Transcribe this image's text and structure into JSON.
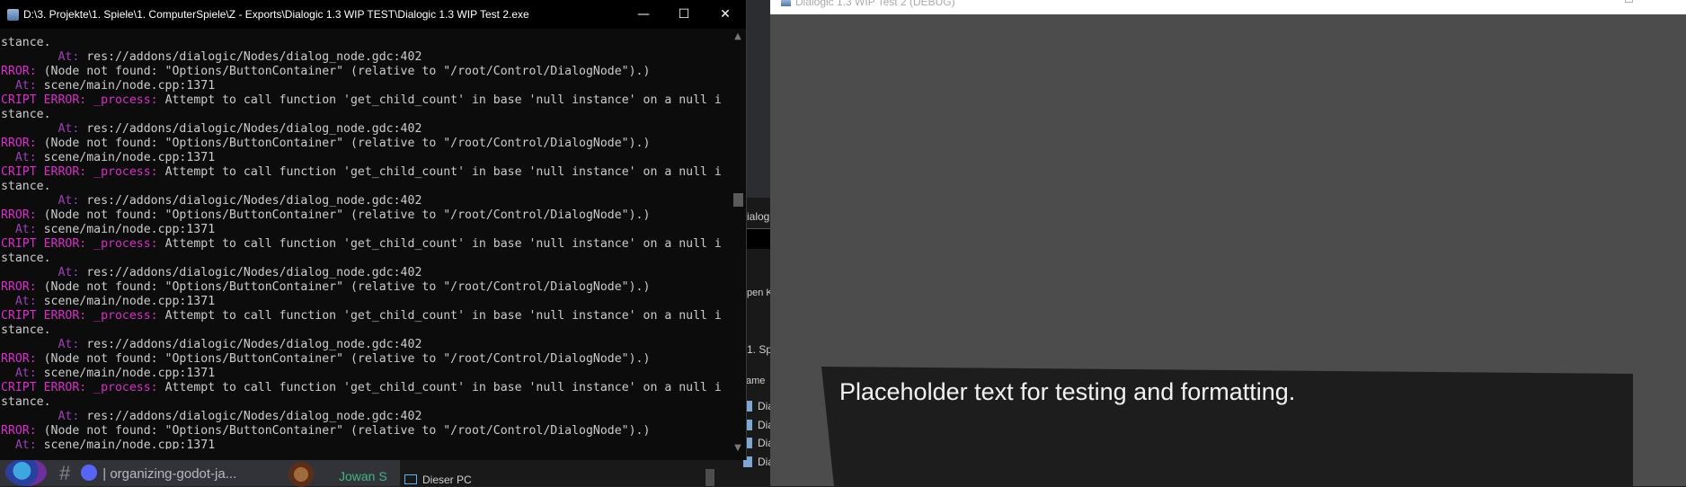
{
  "discord": {
    "channel": "| organizing-godot-ja...",
    "username": "Jowan S"
  },
  "explorer": {
    "labels": [
      "ialog",
      "pen K",
      "1. Sp",
      "ame"
    ],
    "files": [
      "Dia",
      "Dia",
      "Dia",
      "Dia"
    ],
    "this_pc": "Dieser PC"
  },
  "console": {
    "title": "D:\\3. Projekte\\1. Spiele\\1. ComputerSpiele\\Z - Exports\\Dialogic 1.3 WIP TEST\\Dialogic 1.3 WIP Test 2.exe",
    "lines": [
      {
        "pre": "",
        "text": "nstance."
      },
      {
        "pre": "         At: ",
        "text": "res://addons/dialogic/Nodes/dialog_node.gdc:402"
      },
      {
        "pre": "ERROR: ",
        "text": "(Node not found: \"Options/ButtonContainer\" (relative to \"/root/Control/DialogNode\").)"
      },
      {
        "pre": "   At: ",
        "text": "scene/main/node.cpp:1371"
      },
      {
        "pre": "SCRIPT ERROR: _process: ",
        "text": "Attempt to call function 'get_child_count' in base 'null instance' on a null i"
      },
      {
        "pre": "",
        "text": "nstance."
      },
      {
        "pre": "         At: ",
        "text": "res://addons/dialogic/Nodes/dialog_node.gdc:402"
      },
      {
        "pre": "ERROR: ",
        "text": "(Node not found: \"Options/ButtonContainer\" (relative to \"/root/Control/DialogNode\").)"
      },
      {
        "pre": "   At: ",
        "text": "scene/main/node.cpp:1371"
      },
      {
        "pre": "SCRIPT ERROR: _process: ",
        "text": "Attempt to call function 'get_child_count' in base 'null instance' on a null i"
      },
      {
        "pre": "",
        "text": "nstance."
      },
      {
        "pre": "         At: ",
        "text": "res://addons/dialogic/Nodes/dialog_node.gdc:402"
      },
      {
        "pre": "ERROR: ",
        "text": "(Node not found: \"Options/ButtonContainer\" (relative to \"/root/Control/DialogNode\").)"
      },
      {
        "pre": "   At: ",
        "text": "scene/main/node.cpp:1371"
      },
      {
        "pre": "SCRIPT ERROR: _process: ",
        "text": "Attempt to call function 'get_child_count' in base 'null instance' on a null i"
      },
      {
        "pre": "",
        "text": "nstance."
      },
      {
        "pre": "         At: ",
        "text": "res://addons/dialogic/Nodes/dialog_node.gdc:402"
      },
      {
        "pre": "ERROR: ",
        "text": "(Node not found: \"Options/ButtonContainer\" (relative to \"/root/Control/DialogNode\").)"
      },
      {
        "pre": "   At: ",
        "text": "scene/main/node.cpp:1371"
      },
      {
        "pre": "SCRIPT ERROR: _process: ",
        "text": "Attempt to call function 'get_child_count' in base 'null instance' on a null i"
      },
      {
        "pre": "",
        "text": "nstance."
      },
      {
        "pre": "         At: ",
        "text": "res://addons/dialogic/Nodes/dialog_node.gdc:402"
      },
      {
        "pre": "ERROR: ",
        "text": "(Node not found: \"Options/ButtonContainer\" (relative to \"/root/Control/DialogNode\").)"
      },
      {
        "pre": "   At: ",
        "text": "scene/main/node.cpp:1371"
      },
      {
        "pre": "SCRIPT ERROR: _process: ",
        "text": "Attempt to call function 'get_child_count' in base 'null instance' on a null i"
      },
      {
        "pre": "",
        "text": "nstance."
      },
      {
        "pre": "         At: ",
        "text": "res://addons/dialogic/Nodes/dialog_node.gdc:402"
      },
      {
        "pre": "ERROR: ",
        "text": "(Node not found: \"Options/ButtonContainer\" (relative to \"/root/Control/DialogNode\").)"
      },
      {
        "pre": "   At: ",
        "text": "scene/main/node.cpp:1371"
      }
    ]
  },
  "game": {
    "title": "Dialogic 1.3 WIP Test 2 (DEBUG)",
    "dialog_text": "Placeholder text for testing and formatting."
  },
  "colors": {
    "console_bg": "#0c0c0c",
    "error_magenta": "#d92dcc",
    "at_purple": "#9b3fb7",
    "game_bg": "#4c4c4c",
    "dialog_bg": "#1d1d1d"
  }
}
